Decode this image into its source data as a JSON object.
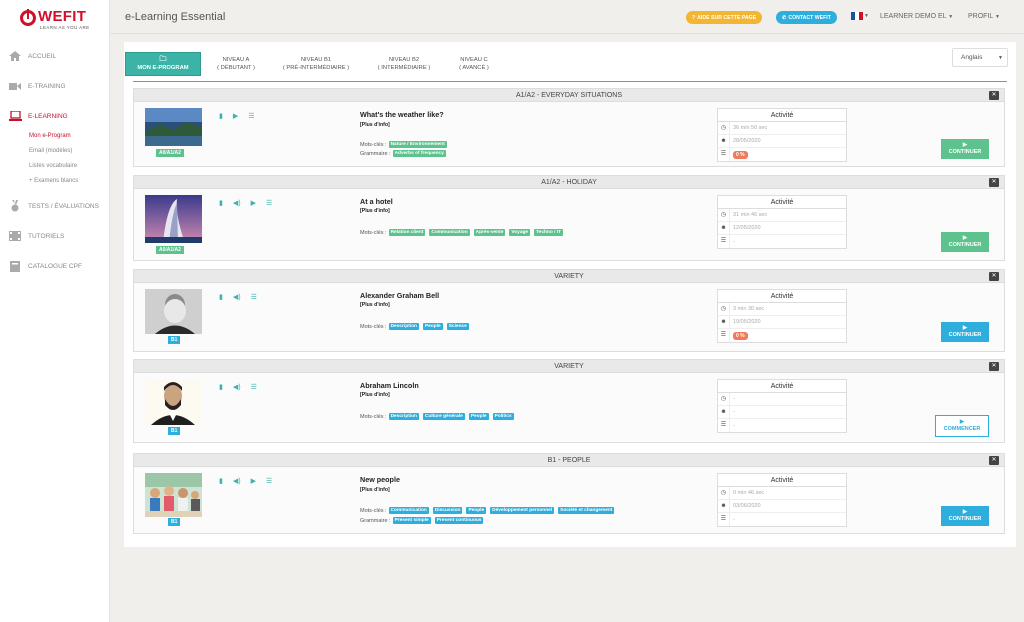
{
  "logo": {
    "word": "WEFIT",
    "tagline": "LEARN AS YOU ARE"
  },
  "sidebar": {
    "items": [
      {
        "label": "Accueil",
        "icon": "home-icon"
      },
      {
        "label": "E-Training",
        "icon": "video-icon"
      },
      {
        "label": "E-Learning",
        "icon": "laptop-icon"
      },
      {
        "label": "Tests / Évaluations",
        "icon": "medal-icon"
      },
      {
        "label": "Tutoriels",
        "icon": "film-icon"
      },
      {
        "label": "Catalogue CPF",
        "icon": "book-icon"
      }
    ],
    "subitems": [
      "Mon e-Program",
      "Email (modèles)",
      "Listes vocabulaire",
      "+ Examens blancs"
    ]
  },
  "header": {
    "title": "e-Learning Essential",
    "help": "AIDE SUR CETTE PAGE",
    "contact": "CONTACT WEFIT",
    "user": "LEARNER DEMO EL",
    "profile": "PROFIL"
  },
  "tabs": [
    {
      "line1": "MON E-PROGRAM",
      "line2": ""
    },
    {
      "line1": "NIVEAU A",
      "line2": "( DÉBUTANT )"
    },
    {
      "line1": "NIVEAU B1",
      "line2": "( PRÉ-INTERMÉDIAIRE )"
    },
    {
      "line1": "NIVEAU B2",
      "line2": "( INTERMÉDIAIRE )"
    },
    {
      "line1": "NIVEAU C",
      "line2": "( AVANCÉ )"
    }
  ],
  "language": "Anglais",
  "labels": {
    "activity": "Activité",
    "more": "[Plus d'info]",
    "keywords": "Mots-clés :",
    "grammar": "Grammaire :"
  },
  "courses": [
    {
      "section": "A1/A2 - EVERYDAY SITUATIONS",
      "title": "What's the weather like?",
      "level": "A0/A1/A2",
      "keywords": [
        "Nature / Environnement"
      ],
      "grammar": [
        "Adverbs of frequency"
      ],
      "time": "36 min 50 sec",
      "date": "28/05/2020",
      "progress": "0 %",
      "cta": "CONTINUER"
    },
    {
      "section": "A1/A2 - HOLIDAY",
      "title": "At a hotel",
      "level": "A0/A1/A2",
      "keywords": [
        "Relation client",
        "Communication",
        "Après-vente",
        "Voyage",
        "Techno / IT"
      ],
      "grammar": [],
      "time": "31 min 46 sec",
      "date": "12/05/2020",
      "progress": "-",
      "cta": "CONTINUER"
    },
    {
      "section": "VARIETY",
      "title": "Alexander Graham Bell",
      "level": "B1",
      "keywords": [
        "Description",
        "People",
        "Science"
      ],
      "grammar": [],
      "time": "3 min 30 sec",
      "date": "19/05/2020",
      "progress": "0 %",
      "cta": "CONTINUER"
    },
    {
      "section": "VARIETY",
      "title": "Abraham Lincoln",
      "level": "B1",
      "keywords": [
        "Description",
        "Culture générale",
        "People",
        "Politics"
      ],
      "grammar": [],
      "time": "-",
      "date": "-",
      "progress": "-",
      "cta": "COMMENCER"
    },
    {
      "section": "B1 - PEOPLE",
      "title": "New people",
      "level": "B1",
      "keywords": [
        "Communication",
        "Discussion",
        "People",
        "Développement personnel",
        "Société et changement"
      ],
      "grammar": [
        "Present simple",
        "Present continuous"
      ],
      "time": "0 min 46 sec",
      "date": "03/06/2020",
      "progress": "-",
      "cta": "CONTINUER"
    }
  ],
  "colors": {
    "brand_red": "#c8102e",
    "teal": "#3bb3a7",
    "green": "#5ec28e",
    "blue": "#2eaedd",
    "orange": "#ef7b5a",
    "yellow": "#f2b632"
  }
}
